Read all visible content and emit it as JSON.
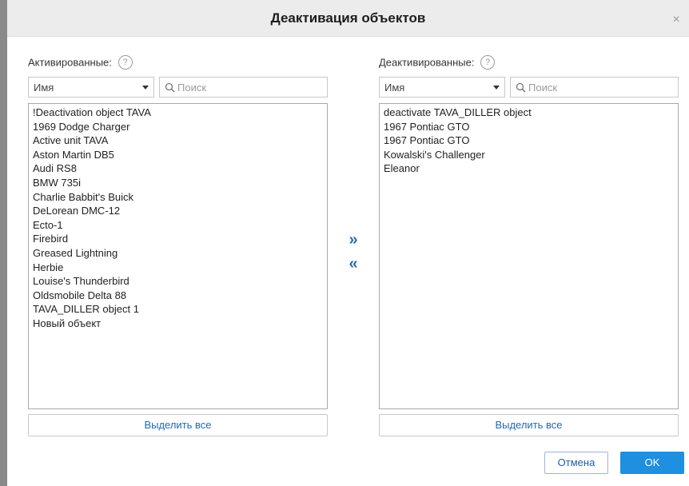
{
  "dialog": {
    "title": "Деактивация объектов",
    "close_symbol": "×"
  },
  "left": {
    "label": "Активированные:",
    "help": "?",
    "sort_select": "Имя",
    "search_placeholder": "Поиск",
    "items": [
      "!Deactivation object TAVA",
      "1969 Dodge Charger",
      "Active unit TAVA",
      "Aston Martin DB5",
      "Audi RS8",
      "BMW 735i",
      "Charlie Babbit's Buick",
      "DeLorean DMC-12",
      "Ecto-1",
      "Firebird",
      "Greased Lightning",
      "Herbie",
      "Louise's Thunderbird",
      "Oldsmobile Delta 88",
      "TAVA_DILLER object 1",
      "Новый объект"
    ],
    "select_all": "Выделить все"
  },
  "right": {
    "label": "Деактивированные:",
    "help": "?",
    "sort_select": "Имя",
    "search_placeholder": "Поиск",
    "items": [
      "deactivate TAVA_DILLER object",
      "1967 Pontiac GTO",
      "1967 Pontiac GTO",
      "Kowalski's Challenger",
      "Eleanor"
    ],
    "select_all": "Выделить все"
  },
  "transfer": {
    "move_right": "»",
    "move_left": "«"
  },
  "footer": {
    "cancel": "Отмена",
    "ok": "OK"
  },
  "colors": {
    "accent": "#1f8fe0",
    "link": "#1e6ab8",
    "titlebar": "#ececec"
  },
  "icons": {
    "search": "search-icon",
    "help": "help-icon",
    "close": "close-icon",
    "caret": "chevron-down-icon"
  }
}
